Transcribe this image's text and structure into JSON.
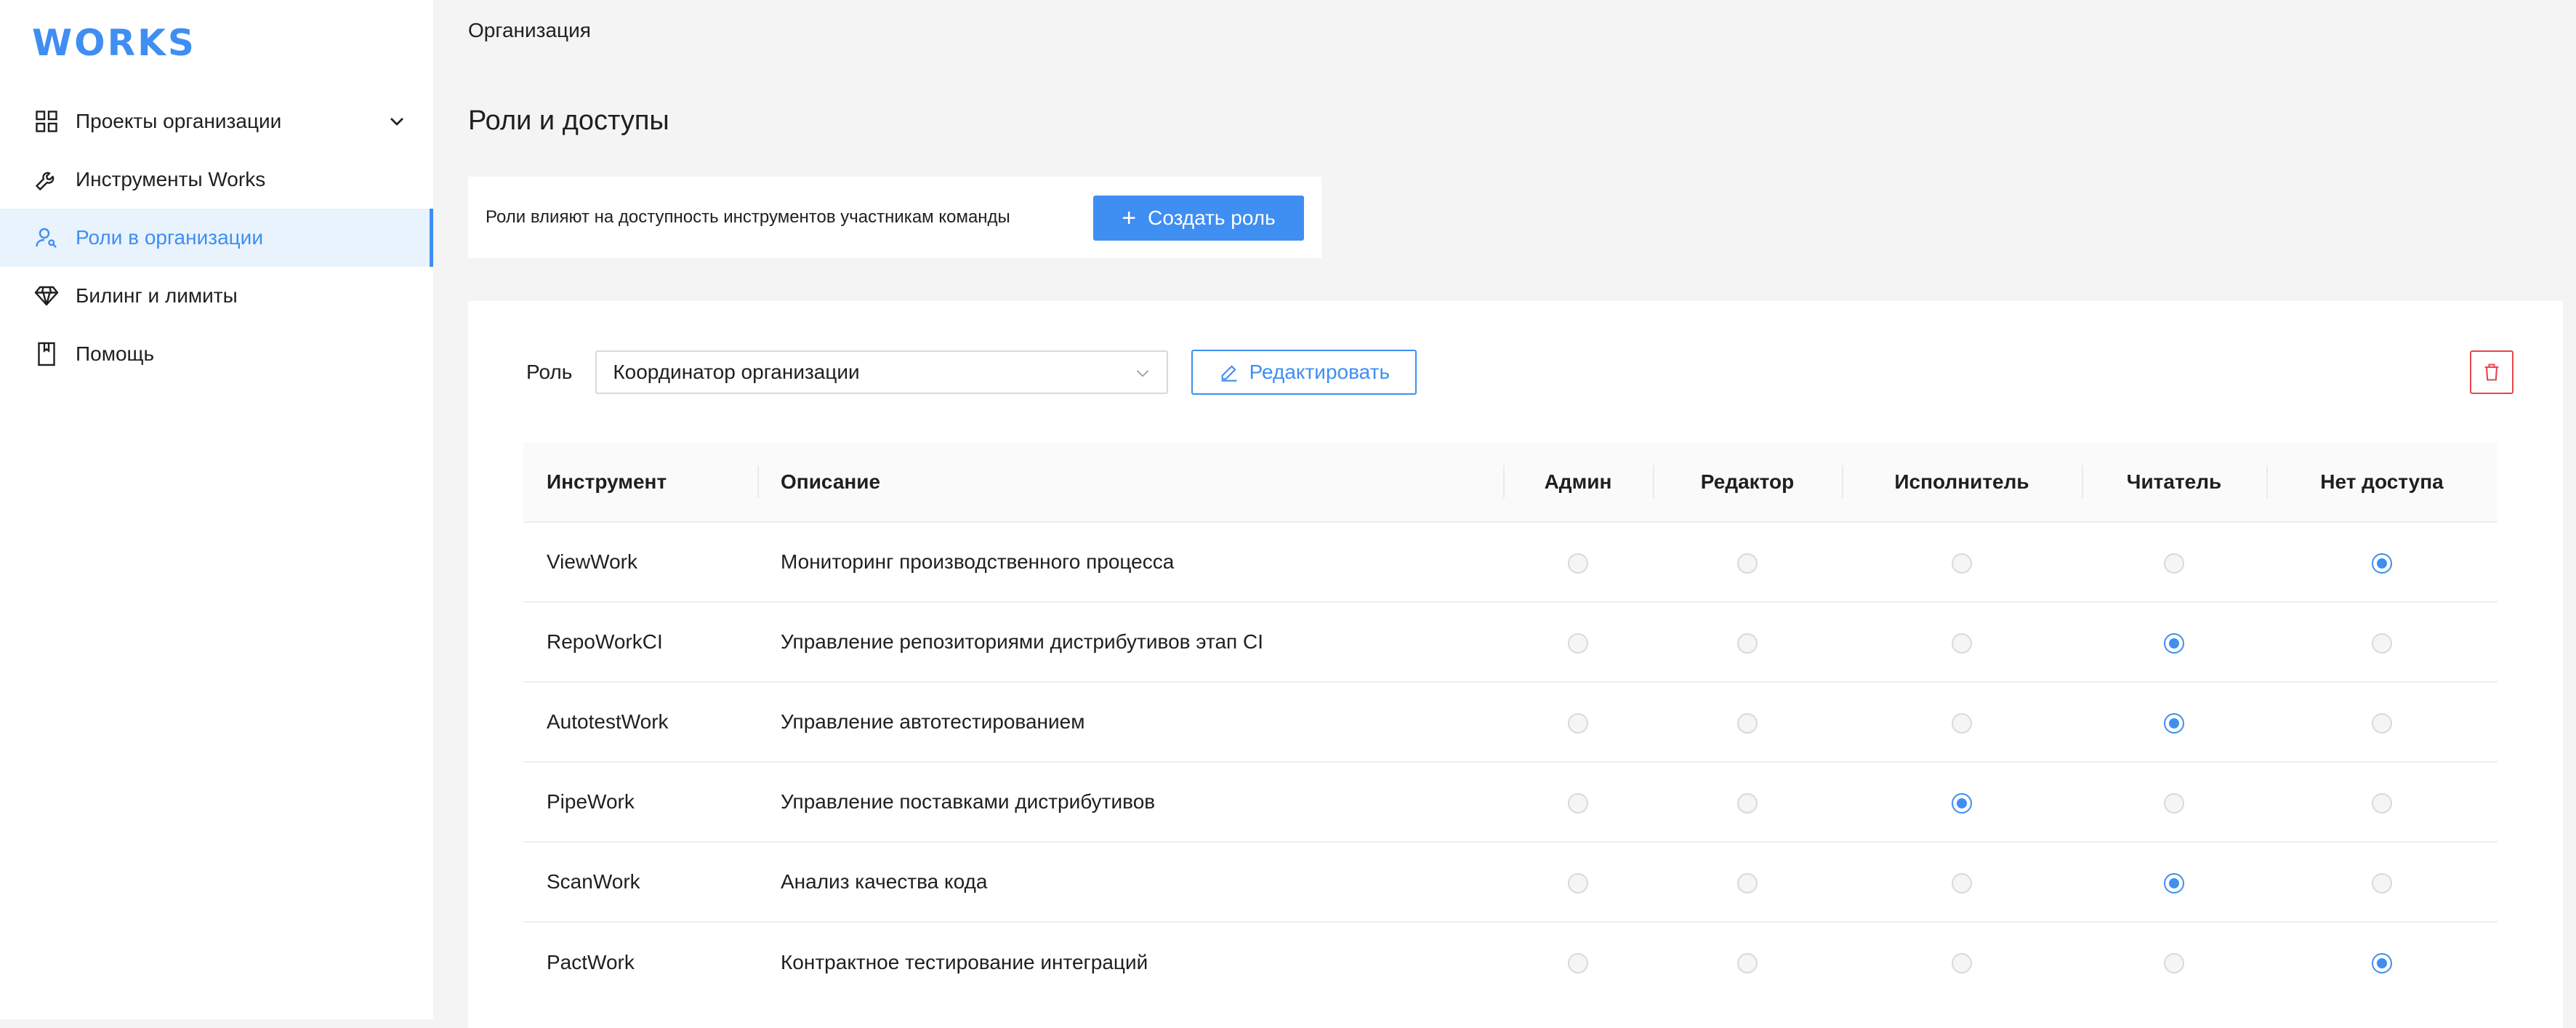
{
  "logo": "WORKS",
  "colors": {
    "accent": "#3f8ef2",
    "danger": "#e5484d"
  },
  "sidebar": {
    "items": [
      {
        "label": "Проекты организации",
        "icon": "grid-icon",
        "expandable": true
      },
      {
        "label": "Инструменты Works",
        "icon": "wrench-icon"
      },
      {
        "label": "Роли в организации",
        "icon": "user-roles-icon",
        "active": true
      },
      {
        "label": "Билинг и лимиты",
        "icon": "diamond-icon"
      },
      {
        "label": "Помощь",
        "icon": "book-icon"
      }
    ]
  },
  "breadcrumb": "Организация",
  "page_title": "Роли и доступы",
  "info": {
    "text": "Роли влияют на доступность инструментов участникам команды",
    "create_button": "Создать роль"
  },
  "role": {
    "label": "Роль",
    "selected": "Координатор организации",
    "edit_button": "Редактировать"
  },
  "table": {
    "headers": {
      "tool": "Инструмент",
      "desc": "Описание",
      "levels": [
        "Админ",
        "Редактор",
        "Исполнитель",
        "Читатель",
        "Нет доступа"
      ]
    },
    "rows": [
      {
        "tool": "ViewWork",
        "desc": "Мониторинг производственного процесса",
        "level": 4
      },
      {
        "tool": "RepoWorkCI",
        "desc": "Управление репозиториями дистрибутивов этап CI",
        "level": 3
      },
      {
        "tool": "AutotestWork",
        "desc": "Управление автотестированием",
        "level": 3
      },
      {
        "tool": "PipeWork",
        "desc": "Управление поставками дистрибутивов",
        "level": 2
      },
      {
        "tool": "ScanWork",
        "desc": "Анализ качества кода",
        "level": 3
      },
      {
        "tool": "PactWork",
        "desc": "Контрактное тестирование интеграций",
        "level": 4
      }
    ]
  }
}
